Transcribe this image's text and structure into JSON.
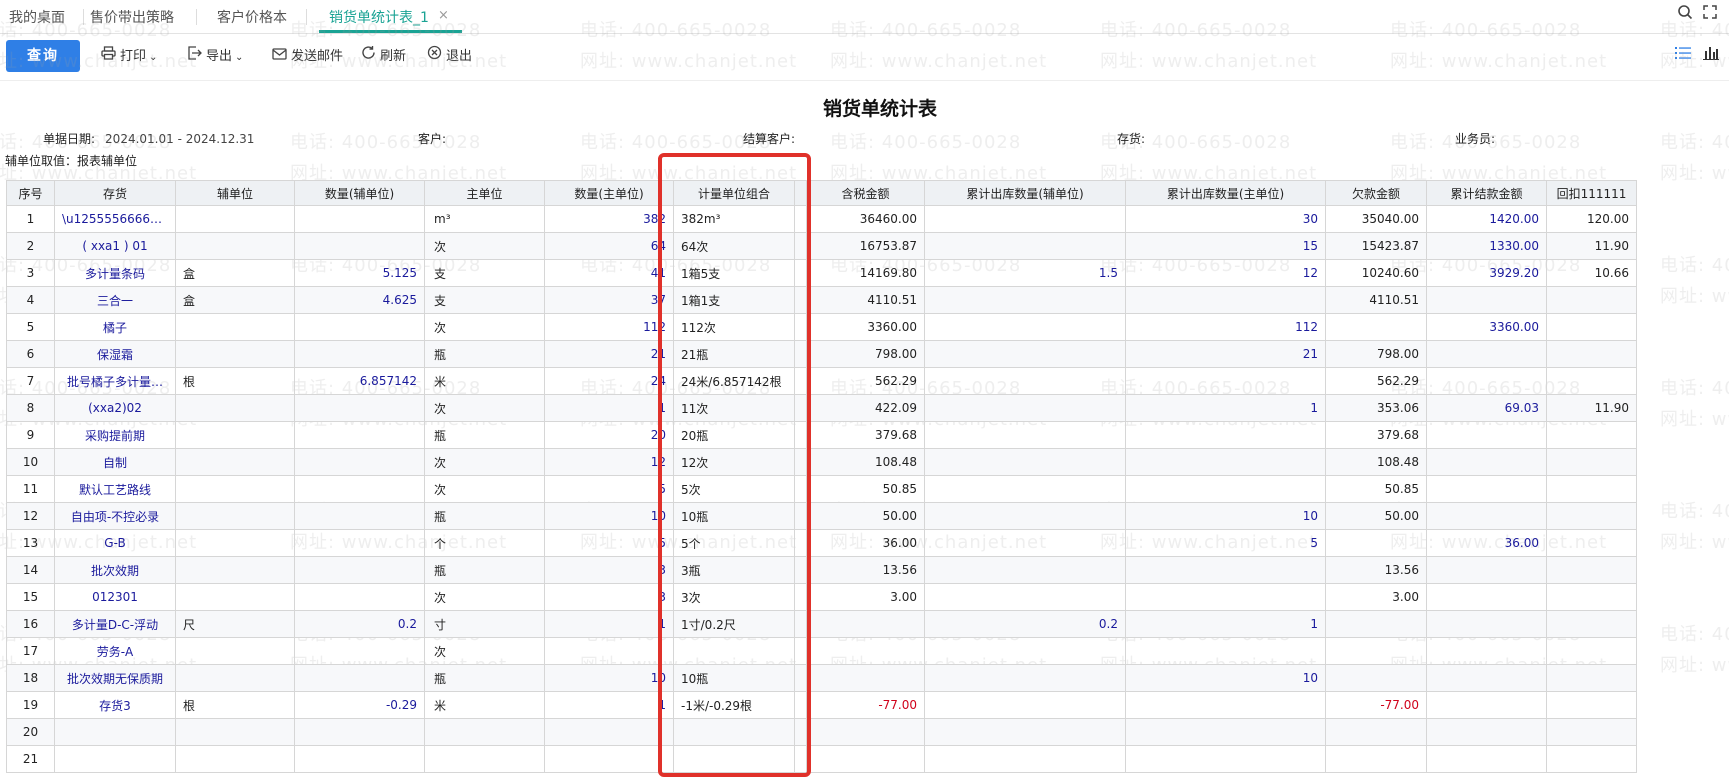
{
  "tabs": [
    {
      "label": "我的桌面"
    },
    {
      "label": "售价带出策略"
    },
    {
      "label": "客户价格本"
    },
    {
      "label": "销货单统计表_1"
    }
  ],
  "tab_close": "×",
  "toolbar": {
    "query": "查询",
    "print": "打印",
    "export": "导出",
    "email": "发送邮件",
    "refresh": "刷新",
    "exit": "退出"
  },
  "report": {
    "title": "销货单统计表",
    "date_label": "单据日期:",
    "date_value": "2024.01.01 - 2024.12.31",
    "customer_label": "客户:",
    "settle_customer_label": "结算客户:",
    "inventory_label": "存货:",
    "salesman_label": "业务员:",
    "aux_note": "辅单位取值：报表辅单位"
  },
  "watermark": {
    "phone": "电话: 400-665-0028",
    "site": "网址: www.chanjet.net"
  },
  "columns": [
    "序号",
    "存货",
    "辅单位",
    "数量(辅单位)",
    "主单位",
    "数量(主单位)",
    "计量单位组合",
    "",
    "含税金额",
    "累计出库数量(辅单位)",
    "累计出库数量(主单位)",
    "欠款金额",
    "累计结款金额",
    "回扣111111"
  ],
  "rows": [
    [
      "1",
      "\\u125555666668…",
      "",
      "",
      "m³",
      "382",
      "382m³",
      "",
      "36460.00",
      "",
      "30",
      "35040.00",
      "1420.00",
      "120.00"
    ],
    [
      "2",
      "( xxa1 ) 01",
      "",
      "",
      "次",
      "64",
      "64次",
      "",
      "16753.87",
      "",
      "15",
      "15423.87",
      "1330.00",
      "11.90"
    ],
    [
      "3",
      "多计量条码",
      "盒",
      "5.125",
      "支",
      "41",
      "1箱5支",
      "",
      "14169.80",
      "1.5",
      "12",
      "10240.60",
      "3929.20",
      "10.66"
    ],
    [
      "4",
      "三合一",
      "盒",
      "4.625",
      "支",
      "37",
      "1箱1支",
      "",
      "4110.51",
      "",
      "",
      "4110.51",
      "",
      ""
    ],
    [
      "5",
      "橘子",
      "",
      "",
      "次",
      "112",
      "112次",
      "",
      "3360.00",
      "",
      "112",
      "",
      "3360.00",
      ""
    ],
    [
      "6",
      "保湿霜",
      "",
      "",
      "瓶",
      "21",
      "21瓶",
      "",
      "798.00",
      "",
      "21",
      "798.00",
      "",
      ""
    ],
    [
      "7",
      "批号橘子多计量…",
      "根",
      "6.857142",
      "米",
      "24",
      "24米/6.857142根",
      "",
      "562.29",
      "",
      "",
      "562.29",
      "",
      ""
    ],
    [
      "8",
      "(xxa2)02",
      "",
      "",
      "次",
      "1",
      "11次",
      "",
      "422.09",
      "",
      "1",
      "353.06",
      "69.03",
      "11.90"
    ],
    [
      "9",
      "采购提前期",
      "",
      "",
      "瓶",
      "20",
      "20瓶",
      "",
      "379.68",
      "",
      "",
      "379.68",
      "",
      ""
    ],
    [
      "10",
      "自制",
      "",
      "",
      "次",
      "12",
      "12次",
      "",
      "108.48",
      "",
      "",
      "108.48",
      "",
      ""
    ],
    [
      "11",
      "默认工艺路线",
      "",
      "",
      "次",
      "5",
      "5次",
      "",
      "50.85",
      "",
      "",
      "50.85",
      "",
      ""
    ],
    [
      "12",
      "自由项-不控必录",
      "",
      "",
      "瓶",
      "10",
      "10瓶",
      "",
      "50.00",
      "",
      "10",
      "50.00",
      "",
      ""
    ],
    [
      "13",
      "G-B",
      "",
      "",
      "个",
      "5",
      "5个",
      "",
      "36.00",
      "",
      "5",
      "",
      "36.00",
      ""
    ],
    [
      "14",
      "批次效期",
      "",
      "",
      "瓶",
      "3",
      "3瓶",
      "",
      "13.56",
      "",
      "",
      "13.56",
      "",
      ""
    ],
    [
      "15",
      "012301",
      "",
      "",
      "次",
      "3",
      "3次",
      "",
      "3.00",
      "",
      "",
      "3.00",
      "",
      ""
    ],
    [
      "16",
      "多计量D-C-浮动",
      "尺",
      "0.2",
      "寸",
      "1",
      "1寸/0.2尺",
      "",
      "",
      "0.2",
      "1",
      "",
      "",
      ""
    ],
    [
      "17",
      "劳务-A",
      "",
      "",
      "次",
      "",
      "",
      "",
      "",
      "",
      "",
      "",
      "",
      ""
    ],
    [
      "18",
      "批次效期无保质期",
      "",
      "",
      "瓶",
      "10",
      "10瓶",
      "",
      "",
      "",
      "10",
      "",
      "",
      ""
    ],
    [
      "19",
      "存货3",
      "根",
      "-0.29",
      "米",
      "1",
      "-1米/-0.29根",
      "",
      "-77.00",
      "",
      "",
      "-77.00",
      "",
      ""
    ],
    [
      "20",
      "",
      "",
      "",
      "",
      "",
      "",
      "",
      "",
      "",
      "",
      "",
      "",
      ""
    ],
    [
      "21",
      "",
      "",
      "",
      "",
      "",
      "",
      "",
      "",
      "",
      "",
      "",
      "",
      ""
    ]
  ]
}
